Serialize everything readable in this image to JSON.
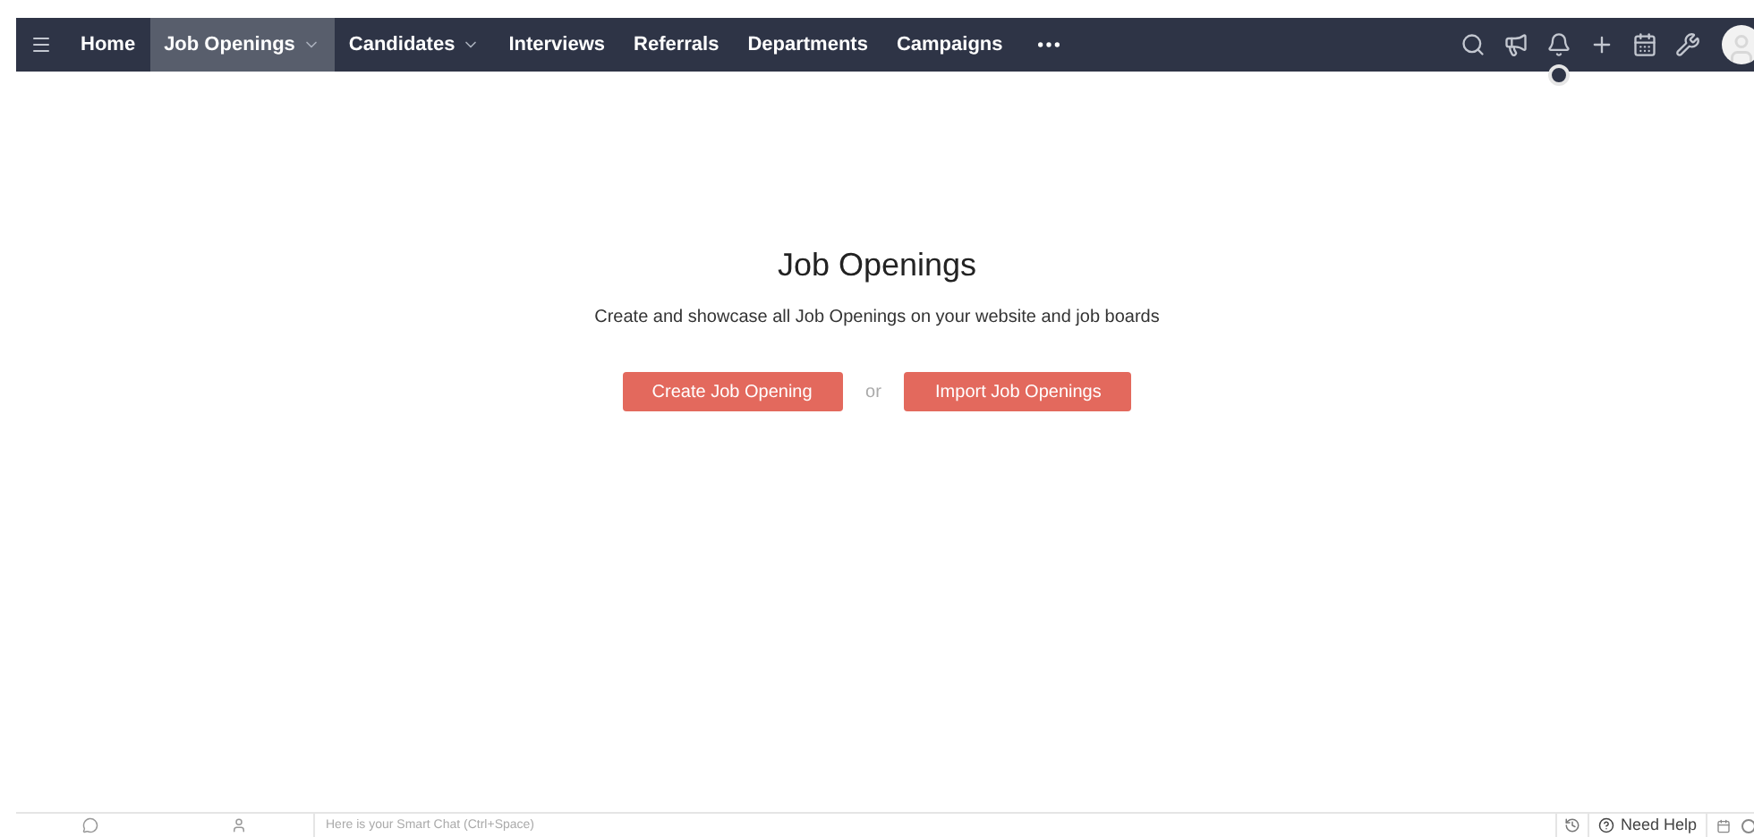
{
  "nav": {
    "items": [
      {
        "label": "Home",
        "selected": false,
        "caret": false
      },
      {
        "label": "Job Openings",
        "selected": true,
        "caret": true
      },
      {
        "label": "Candidates",
        "selected": false,
        "caret": true
      },
      {
        "label": "Interviews",
        "selected": false,
        "caret": false
      },
      {
        "label": "Referrals",
        "selected": false,
        "caret": false
      },
      {
        "label": "Departments",
        "selected": false,
        "caret": false
      },
      {
        "label": "Campaigns",
        "selected": false,
        "caret": false
      }
    ]
  },
  "empty_state": {
    "title": "Job Openings",
    "description": "Create and showcase all Job Openings on your website and job boards",
    "primary_button": "Create Job Opening",
    "separator": "or",
    "secondary_button": "Import Job Openings"
  },
  "footer": {
    "chat_placeholder": "Here is your Smart Chat (Ctrl+Space)",
    "help_label": "Need Help"
  }
}
